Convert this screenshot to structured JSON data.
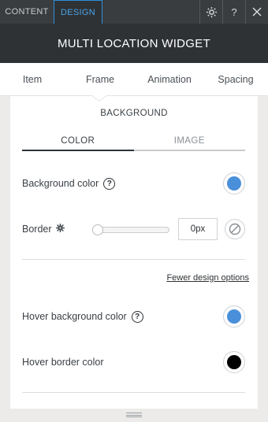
{
  "top_tabs": {
    "content": "CONTENT",
    "design": "DESIGN"
  },
  "top_icons": {
    "settings": "gear-icon",
    "help": "?",
    "close": "close-icon"
  },
  "header": {
    "title": "MULTI LOCATION WIDGET"
  },
  "sub_tabs": [
    "Item",
    "Frame",
    "Animation",
    "Spacing"
  ],
  "section": {
    "title": "BACKGROUND",
    "tabs": [
      "COLOR",
      "IMAGE"
    ],
    "active_tab": "COLOR"
  },
  "background_color": {
    "label": "Background color",
    "help": "?",
    "color": "#4a8fd9"
  },
  "border": {
    "label": "Border",
    "value": "0px",
    "slider_level": 0
  },
  "fewer_link": "Fewer design options",
  "hover_background": {
    "label": "Hover background color",
    "help": "?",
    "color": "#4a8fd9"
  },
  "hover_border": {
    "label": "Hover border color",
    "color": "#000000"
  }
}
